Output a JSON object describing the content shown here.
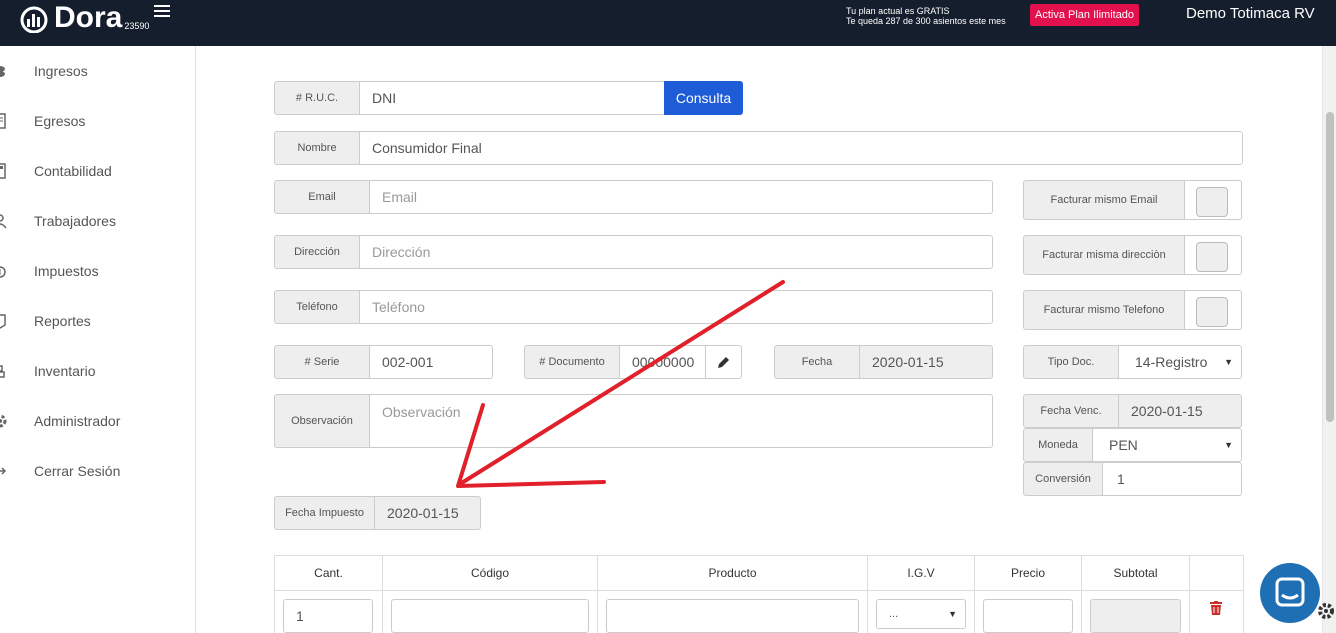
{
  "header": {
    "brand": "Dora",
    "account_number": "23590",
    "plan_line1": "Tu plan actual es GRATIS",
    "plan_line2": "Te queda 287 de 300 asientos este mes",
    "upgrade_label": "Activa Plan Ilimitado",
    "user_name": "Demo Totimaca RV"
  },
  "sidebar": {
    "items": [
      {
        "label": "Ingresos",
        "icon": "coins-icon"
      },
      {
        "label": "Egresos",
        "icon": "receipt-icon"
      },
      {
        "label": "Contabilidad",
        "icon": "calculator-icon"
      },
      {
        "label": "Trabajadores",
        "icon": "users-icon"
      },
      {
        "label": "Impuestos",
        "icon": "tax-icon"
      },
      {
        "label": "Reportes",
        "icon": "report-icon"
      },
      {
        "label": "Inventario",
        "icon": "boxes-icon"
      },
      {
        "label": "Administrador",
        "icon": "gear-icon"
      },
      {
        "label": "Cerrar Sesión",
        "icon": "logout-icon"
      }
    ]
  },
  "form": {
    "ruc_label": "# R.U.C.",
    "ruc_value": "DNI",
    "consulta_label": "Consulta",
    "nombre_label": "Nombre",
    "nombre_value": "Consumidor Final",
    "email_label": "Email",
    "email_placeholder": "Email",
    "direccion_label": "Dirección",
    "direccion_placeholder": "Dirección",
    "telefono_label": "Teléfono",
    "telefono_placeholder": "Teléfono",
    "facturar_email_label": "Facturar mismo Email",
    "facturar_direccion_label": "Facturar misma direcciòn",
    "facturar_telefono_label": "Facturar mismo Telefono",
    "serie_label": "# Serie",
    "serie_value": "002-001",
    "documento_label": "# Documento",
    "documento_value": "00000000",
    "fecha_label": "Fecha",
    "fecha_value": "2020-01-15",
    "tipo_doc_label": "Tipo Doc.",
    "tipo_doc_value": "14-Registro",
    "observacion_label": "Observación",
    "observacion_placeholder": "Observación",
    "fecha_venc_label": "Fecha Venc.",
    "fecha_venc_value": "2020-01-15",
    "moneda_label": "Moneda",
    "moneda_value": "PEN",
    "conversion_label": "Conversión",
    "conversion_value": "1",
    "fecha_impuesto_label": "Fecha Impuesto",
    "fecha_impuesto_value": "2020-01-15"
  },
  "items_table": {
    "headers": [
      "Cant.",
      "Código",
      "Producto",
      "I.G.V",
      "Precio",
      "Subtotal"
    ],
    "row": {
      "cantidad": "1",
      "igv": "..."
    }
  },
  "colors": {
    "topbar": "#151e2d",
    "upgrade": "#e3104e",
    "consulta": "#1e5bd6",
    "annotation_arrow": "#e0202a",
    "trash": "#c9302c",
    "chat": "#1f6fb5"
  }
}
